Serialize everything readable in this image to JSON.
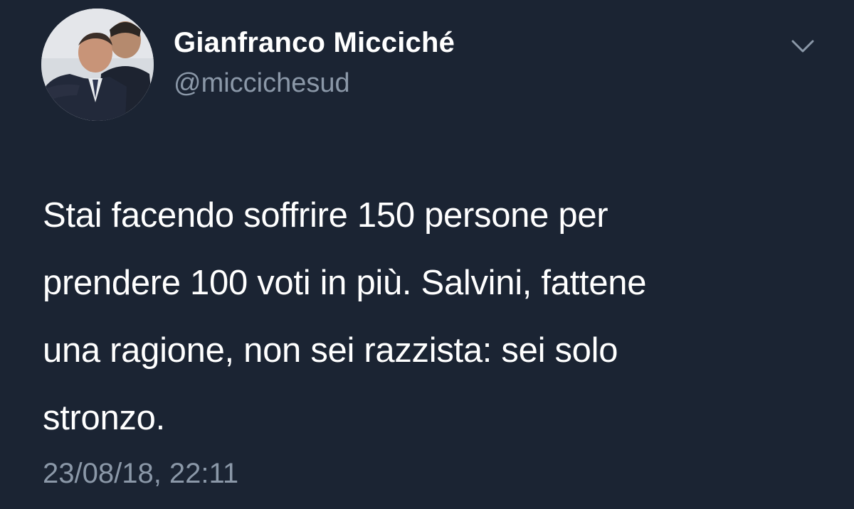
{
  "user": {
    "display_name": "Gianfranco Micciché",
    "handle": "@miccichesud"
  },
  "icons": {
    "menu": "chevron-down-icon",
    "avatar": "profile-photo"
  },
  "tweet": {
    "lines": [
      "Stai facendo soffrire 150 persone per",
      "prendere 100 voti in più. Salvini, fattene",
      "una ragione, non sei razzista: sei solo",
      "stronzo."
    ],
    "timestamp": "23/08/18, 22:11"
  },
  "colors": {
    "background": "#1b2433",
    "text_primary": "#ffffff",
    "text_secondary": "#8b98a8"
  }
}
